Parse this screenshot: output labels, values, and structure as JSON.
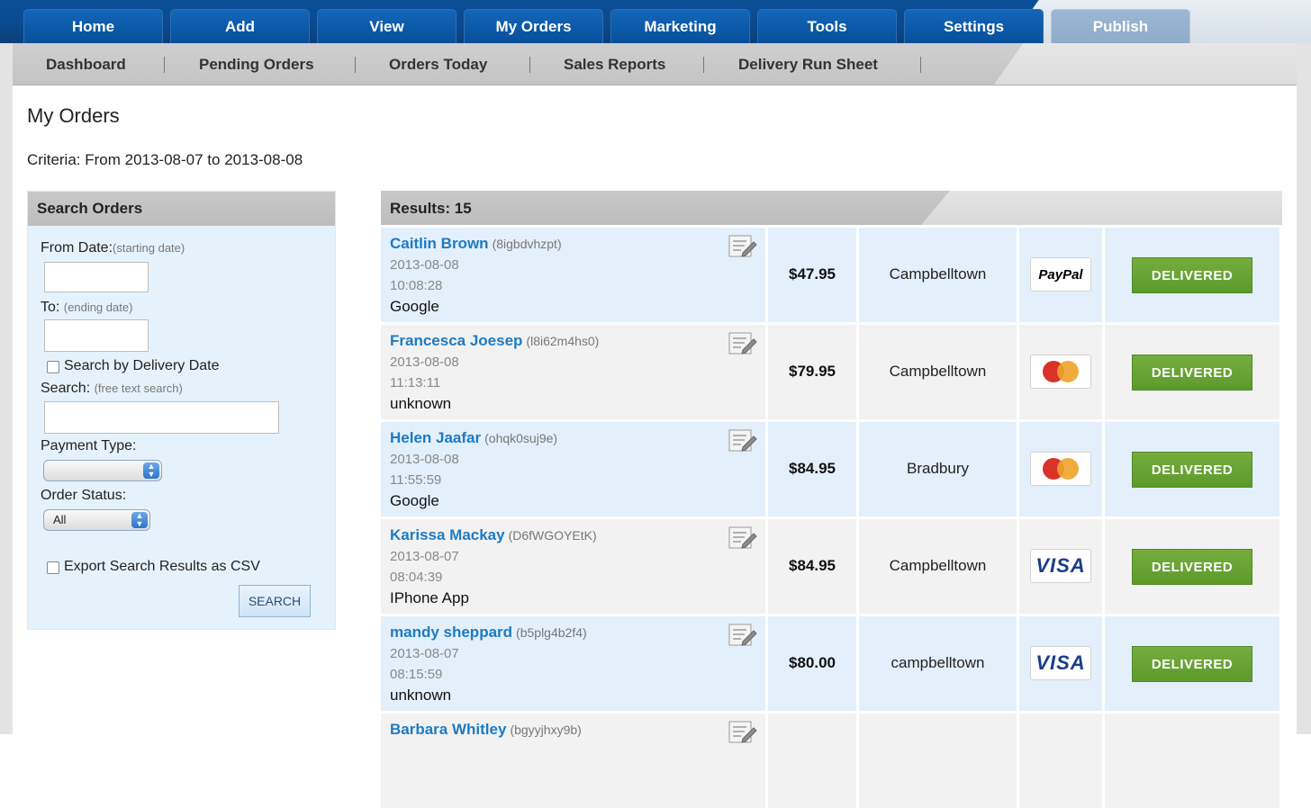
{
  "nav": {
    "tabs": [
      {
        "label": "Home"
      },
      {
        "label": "Add"
      },
      {
        "label": "View"
      },
      {
        "label": "My Orders"
      },
      {
        "label": "Marketing"
      },
      {
        "label": "Tools"
      },
      {
        "label": "Settings"
      },
      {
        "label": "Publish"
      }
    ],
    "subnav": [
      {
        "label": "Dashboard"
      },
      {
        "label": "Pending Orders"
      },
      {
        "label": "Orders Today"
      },
      {
        "label": "Sales Reports"
      },
      {
        "label": "Delivery Run Sheet"
      }
    ]
  },
  "page": {
    "title": "My Orders",
    "criteria": "Criteria: From 2013-08-07 to 2013-08-08"
  },
  "search": {
    "header": "Search Orders",
    "from_label": "From Date:",
    "from_hint": "(starting date)",
    "from_value": "",
    "to_label": "To:",
    "to_hint": "(ending date)",
    "to_value": "",
    "delivery_date_label": "Search by Delivery Date",
    "delivery_date_checked": false,
    "search_label": "Search:",
    "search_hint": "(free text search)",
    "search_value": "",
    "payment_type_label": "Payment Type:",
    "payment_type_value": "",
    "order_status_label": "Order Status:",
    "order_status_value": "All",
    "export_label": "Export Search Results as CSV",
    "export_checked": false,
    "button": "SEARCH"
  },
  "results": {
    "header": "Results: 15",
    "rows": [
      {
        "name": "Caitlin Brown",
        "code": "(8igbdvhzpt)",
        "date": "2013-08-08",
        "time": "10:08:28",
        "source": "Google",
        "amount": "$47.95",
        "location": "Campbelltown",
        "payment": "paypal",
        "payment_label": "PayPal",
        "status": "DELIVERED"
      },
      {
        "name": "Francesca Joesep",
        "code": "(l8i62m4hs0)",
        "date": "2013-08-08",
        "time": "11:13:11",
        "source": "unknown",
        "amount": "$79.95",
        "location": "Campbelltown",
        "payment": "mastercard",
        "payment_label": "",
        "status": "DELIVERED"
      },
      {
        "name": "Helen Jaafar",
        "code": "(ohqk0suj9e)",
        "date": "2013-08-08",
        "time": "11:55:59",
        "source": "Google",
        "amount": "$84.95",
        "location": "Bradbury",
        "payment": "mastercard",
        "payment_label": "",
        "status": "DELIVERED"
      },
      {
        "name": "Karissa Mackay",
        "code": "(D6fWGOYEtK)",
        "date": "2013-08-07",
        "time": "08:04:39",
        "source": "IPhone App",
        "amount": "$84.95",
        "location": "Campbelltown",
        "payment": "visa",
        "payment_label": "VISA",
        "status": "DELIVERED"
      },
      {
        "name": "mandy sheppard",
        "code": "(b5plg4b2f4)",
        "date": "2013-08-07",
        "time": "08:15:59",
        "source": "unknown",
        "amount": "$80.00",
        "location": "campbelltown",
        "payment": "visa",
        "payment_label": "VISA",
        "status": "DELIVERED"
      },
      {
        "name": "Barbara Whitley",
        "code": "(bgyyjhxy9b)",
        "date": "",
        "time": "",
        "source": "",
        "amount": "",
        "location": "",
        "payment": "",
        "payment_label": "",
        "status": ""
      }
    ]
  },
  "colors": {
    "nav_blue": "#0b58a7",
    "link_blue": "#1d7bc4",
    "delivered_green": "#5d9a2c",
    "row_blue": "#e3effb",
    "row_grey": "#f2f2f2"
  }
}
